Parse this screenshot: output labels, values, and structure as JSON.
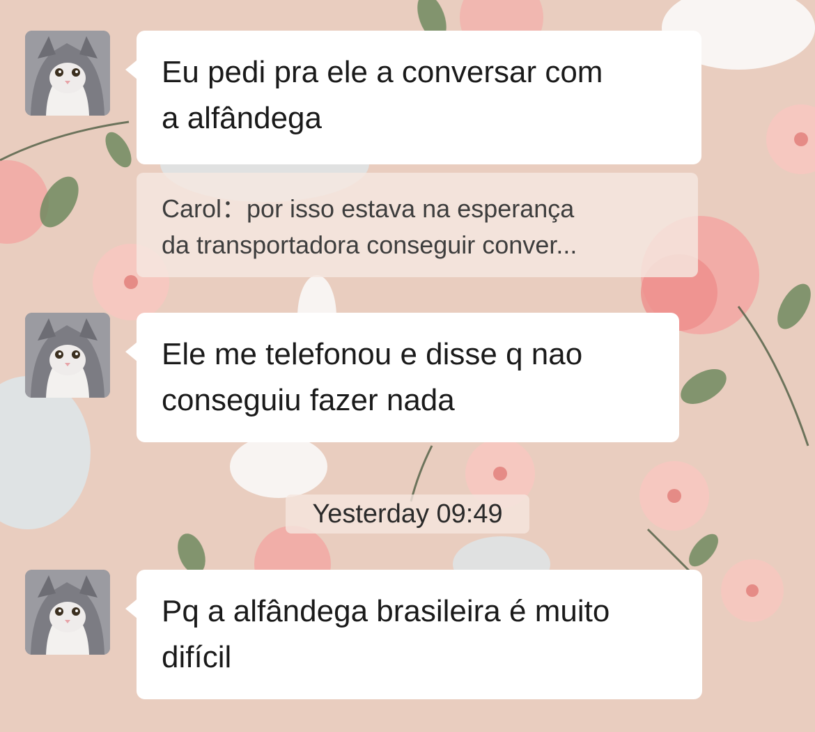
{
  "messages": [
    {
      "lines": [
        "Eu pedi pra ele a conversar com",
        "a alfândega"
      ]
    },
    {
      "lines": [
        "Ele me telefonou e disse q nao",
        "conseguiu fazer nada"
      ]
    },
    {
      "lines": [
        "Pq a alfândega brasileira é muito",
        "difícil"
      ]
    }
  ],
  "quote": {
    "lines": [
      "Carol：por isso estava na esperança",
      "da transportadora conseguir conver..."
    ]
  },
  "timestamp": "Yesterday 09:49",
  "colors": {
    "wallpaper": "#e9cdbf",
    "bubble": "#ffffff",
    "quote_bg": "#f5e8e1",
    "text": "#1a1a1a"
  },
  "avatar_icon": "cat-avatar-icon"
}
